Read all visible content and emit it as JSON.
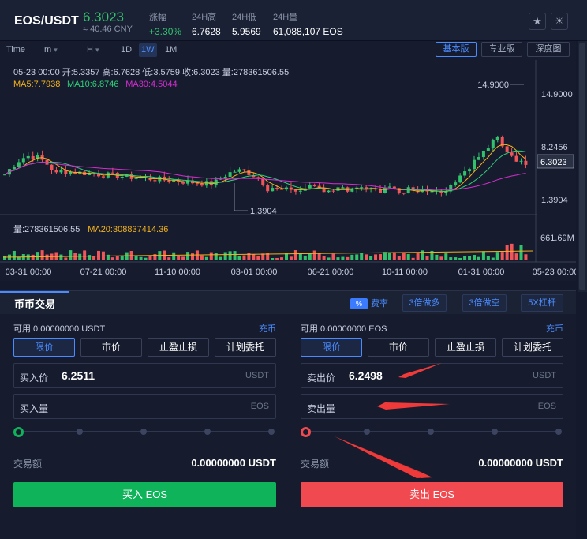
{
  "header": {
    "pair": "EOS/USDT",
    "price": "6.3023",
    "cny": "≈ 40.46 CNY",
    "stats": [
      {
        "label": "涨幅",
        "value": "+3.30%"
      },
      {
        "label": "24H高",
        "value": "6.7628"
      },
      {
        "label": "24H低",
        "value": "5.9569"
      },
      {
        "label": "24H量",
        "value": "61,088,107 EOS"
      }
    ],
    "icons": [
      "star-icon",
      "sun-icon"
    ]
  },
  "toolbar": {
    "timeframes": [
      "Time",
      "m",
      "H",
      "1D",
      "1W",
      "1M"
    ],
    "active_timeframe": "1W",
    "views": [
      "基本版",
      "专业版",
      "深度图"
    ],
    "active_view": "基本版"
  },
  "ohlc": "05-23 00:00  开:5.3357  高:6.7628  低:3.5759  收:6.3023  量:278361506.55",
  "ma_line": [
    {
      "text": "MA5:7.7938",
      "color": "#f5b21a"
    },
    {
      "text": "MA10:6.8746",
      "color": "#2fd07a"
    },
    {
      "text": "MA30:4.5044",
      "color": "#d62dd0"
    }
  ],
  "volume_line": [
    {
      "text": "量:278361506.55",
      "color": "#c9d0e0"
    },
    {
      "text": "MA20:308837414.36",
      "color": "#f5b21a"
    }
  ],
  "chart_data": {
    "type": "candlestick",
    "price_axis_labels": [
      "14.9000",
      "8.2456",
      "6.3023",
      "1.3904"
    ],
    "volume_axis_label": "661.69M",
    "x_tick_labels": [
      "03-31 00:00",
      "07-21 00:00",
      "11-10 00:00",
      "03-01 00:00",
      "06-21 00:00",
      "10-11 00:00",
      "01-31 00:00",
      "05-23 00:00"
    ],
    "max_marker": "14.9000",
    "min_marker": "1.3904",
    "last_price": "6.3023",
    "up_color": "#33c26c",
    "down_color": "#f0555a"
  },
  "trade": {
    "tab": "币币交易",
    "fee_badge": "%",
    "fee_label": "费率",
    "leverage_buttons": [
      "3倍做多",
      "3倍做空",
      "5X杠杆"
    ],
    "buy": {
      "available": "可用  0.00000000 USDT",
      "deposit": "充币",
      "order_types": [
        "限价",
        "市价",
        "止盈止损",
        "计划委托"
      ],
      "price_label": "买入价",
      "price_value": "6.2511",
      "price_unit": "USDT",
      "qty_label": "买入量",
      "qty_unit": "EOS",
      "amount_label": "交易额",
      "amount_value": "0.00000000 USDT",
      "button": "买入 EOS",
      "color": "#0fb35a"
    },
    "sell": {
      "available": "可用  0.00000000 EOS",
      "deposit": "充币",
      "order_types": [
        "限价",
        "市价",
        "止盈止损",
        "计划委托"
      ],
      "price_label": "卖出价",
      "price_value": "6.2498",
      "price_unit": "USDT",
      "qty_label": "卖出量",
      "qty_unit": "EOS",
      "amount_label": "交易额",
      "amount_value": "0.00000000 USDT",
      "button": "卖出 EOS",
      "color": "#f04a50"
    }
  }
}
